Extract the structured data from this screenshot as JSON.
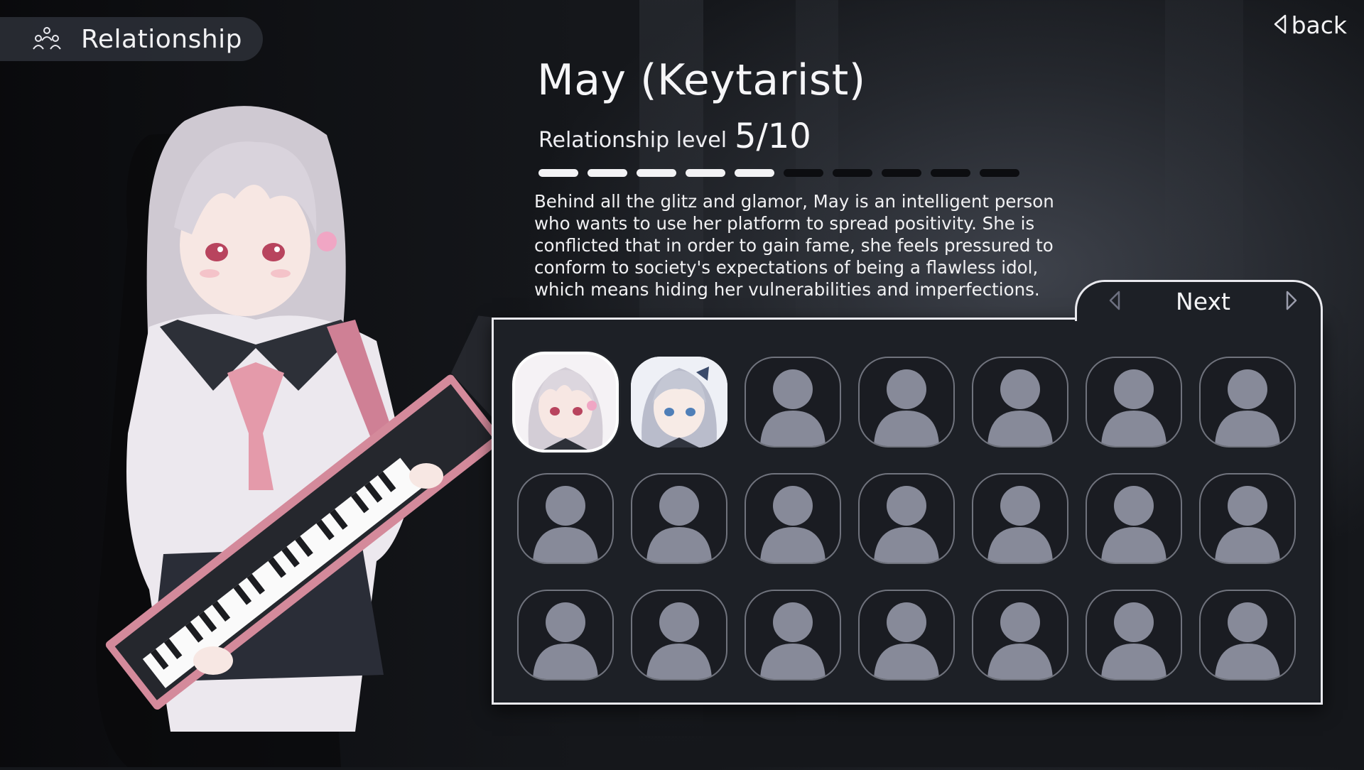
{
  "header": {
    "title": "Relationship",
    "icon": "group-icon"
  },
  "back": {
    "label": "back",
    "icon": "triangle-left-icon"
  },
  "profile": {
    "name": "May (Keytarist)",
    "level_label": "Relationship level",
    "level_value": "5/10",
    "level_current": 5,
    "level_max": 10,
    "description": "Behind all the glitz and glamor, May is an intelligent person who wants to use her platform to spread positivity. She is conflicted that in order to gain fame, she feels pressured to conform to society's expectations of being a flawless idol, which means hiding her vulnerabilities and imperfections."
  },
  "roster": {
    "nav_label": "Next",
    "prev_icon": "triangle-left-icon",
    "next_icon": "triangle-right-icon",
    "slots": [
      {
        "state": "selected",
        "portrait": "may-portrait"
      },
      {
        "state": "unlocked",
        "portrait": "silver-hair-blue-eyes-portrait"
      },
      {
        "state": "locked"
      },
      {
        "state": "locked"
      },
      {
        "state": "locked"
      },
      {
        "state": "locked"
      },
      {
        "state": "locked"
      },
      {
        "state": "locked"
      },
      {
        "state": "locked"
      },
      {
        "state": "locked"
      },
      {
        "state": "locked"
      },
      {
        "state": "locked"
      },
      {
        "state": "locked"
      },
      {
        "state": "locked"
      },
      {
        "state": "locked"
      },
      {
        "state": "locked"
      },
      {
        "state": "locked"
      },
      {
        "state": "locked"
      },
      {
        "state": "locked"
      },
      {
        "state": "locked"
      },
      {
        "state": "locked"
      }
    ]
  },
  "colors": {
    "panel_bg": "#1d2026",
    "panel_border": "#e9e9ee",
    "bar_filled": "#f3f3f5",
    "bar_empty": "#0c0d10",
    "placeholder_silhouette": "#878a99",
    "accent_pink": "#d98a9c"
  }
}
